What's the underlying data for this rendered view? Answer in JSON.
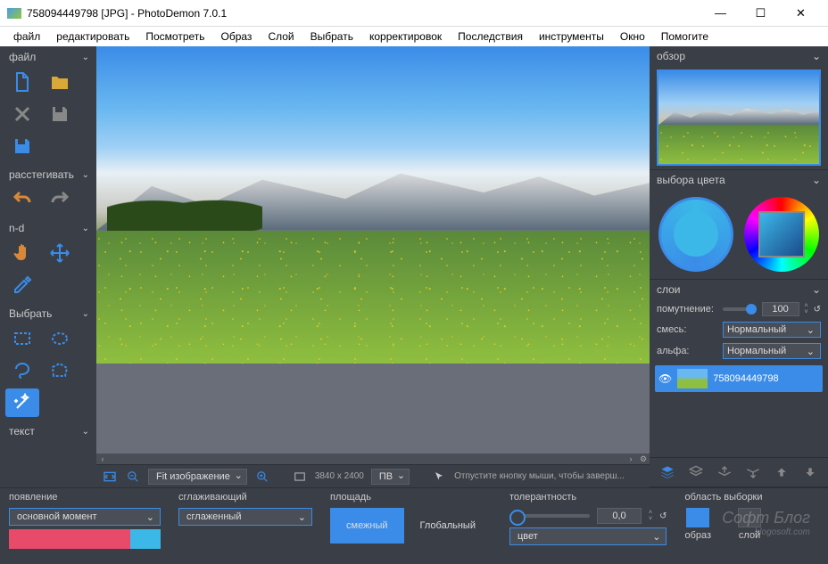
{
  "titlebar": {
    "title": "758094449798 [JPG]  -  PhotoDemon 7.0.1"
  },
  "menu": [
    "файл",
    "редактировать",
    "Посмотреть",
    "Образ",
    "Слой",
    "Выбрать",
    "корректировок",
    "Последствия",
    "инструменты",
    "Окно",
    "Помогите"
  ],
  "toolbox": {
    "file": "файл",
    "undo": "расстегивать",
    "nd": "n-d",
    "select": "Выбрать",
    "text": "текст"
  },
  "status": {
    "fit": "Fit изображение",
    "dims": "3840 x 2400",
    "unit": "ПВ",
    "hint": "Отпустите кнопку мыши, чтобы заверш..."
  },
  "right": {
    "overview": "обзор",
    "colorpick": "выбора цвета",
    "layers": "слои",
    "opacity_label": "помутнение:",
    "opacity_val": "100",
    "blend_label": "смесь:",
    "blend_val": "Нормальный",
    "alpha_label": "альфа:",
    "alpha_val": "Нормальный",
    "layer_name": "758094449798"
  },
  "opts": {
    "appearance_label": "появление",
    "appearance_val": "основной момент",
    "smooth_label": "сглаживающий",
    "smooth_val": "сглаженный",
    "area_label": "площадь",
    "area_contig": "смежный",
    "area_global": "Глобальный",
    "tol_label": "толерантность",
    "tol_val": "0,0",
    "tol_src": "цвет",
    "sample_label": "область выборки",
    "sample_image": "образ",
    "sample_layer": "слой"
  },
  "watermark": {
    "main": "Софт Блог",
    "sub": "blogosoft.com"
  }
}
